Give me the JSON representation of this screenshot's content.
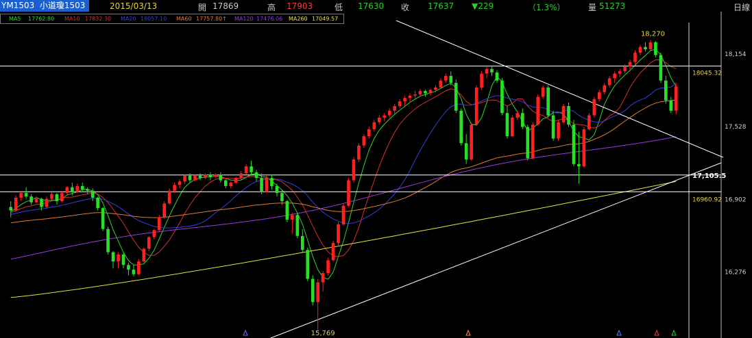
{
  "header": {
    "symbol": "YM1503",
    "name": "小道瓊1503",
    "date": "2015/03/13",
    "open_label": "開",
    "open": "17869",
    "high_label": "高",
    "high": "17903",
    "low_label": "低",
    "low": "17630",
    "close_label": "收",
    "close": "17637",
    "change": "▼229",
    "change_pct": "（1.3%）",
    "volume_label": "量",
    "volume": "51273",
    "period": "日線"
  },
  "ma_legend": [
    {
      "label": "MA5",
      "value": "17762.80",
      "color": "#2dd82d"
    },
    {
      "label": "MA10",
      "value": "17832.30",
      "color": "#d83030"
    },
    {
      "label": "MA20",
      "value": "18057.10",
      "color": "#3040e0"
    },
    {
      "label": "MA60",
      "value": "17757.80↑",
      "color": "#e07a30"
    },
    {
      "label": "MA120",
      "value": "17476.06",
      "color": "#9a3ae0"
    },
    {
      "label": "MA260",
      "value": "17049.57",
      "color": "#e8e040"
    }
  ],
  "colors": {
    "up": "#ff2020",
    "down": "#28e028",
    "bg": "#000000",
    "grid": "#ffffff"
  },
  "chart_data": {
    "type": "candlestick",
    "title": "",
    "ylim": [
      15700,
      18420
    ],
    "y_ticks": [
      "18,154",
      "17,528",
      "16,902",
      "16,276"
    ],
    "levels": [
      {
        "label": "18045.32",
        "value": 18045.32
      },
      {
        "label": "17,105.5",
        "value": 17105.5
      },
      {
        "label": "16960.92",
        "value": 16960.92
      }
    ],
    "annotations": [
      {
        "label": "18,270",
        "value": 18270
      },
      {
        "label": "15,769",
        "value": 15769
      }
    ],
    "candles": [
      [
        16830,
        16880,
        16740,
        16800
      ],
      [
        16800,
        16930,
        16790,
        16910
      ],
      [
        16910,
        16960,
        16880,
        16950
      ],
      [
        16950,
        17000,
        16900,
        16920
      ],
      [
        16920,
        16940,
        16850,
        16870
      ],
      [
        16870,
        16920,
        16860,
        16900
      ],
      [
        16900,
        16910,
        16800,
        16830
      ],
      [
        16830,
        16920,
        16820,
        16900
      ],
      [
        16900,
        16960,
        16890,
        16940
      ],
      [
        16940,
        16950,
        16850,
        16880
      ],
      [
        16880,
        16960,
        16870,
        16950
      ],
      [
        16950,
        17010,
        16930,
        17000
      ],
      [
        17000,
        17040,
        16930,
        16960
      ],
      [
        16960,
        17030,
        16950,
        17010
      ],
      [
        17010,
        17040,
        16960,
        16980
      ],
      [
        16980,
        17000,
        16940,
        16970
      ],
      [
        16970,
        16990,
        16880,
        16910
      ],
      [
        16910,
        16920,
        16800,
        16820
      ],
      [
        16820,
        16830,
        16620,
        16640
      ],
      [
        16640,
        16660,
        16420,
        16440
      ],
      [
        16440,
        16450,
        16300,
        16360
      ],
      [
        16360,
        16440,
        16300,
        16420
      ],
      [
        16420,
        16430,
        16300,
        16330
      ],
      [
        16330,
        16350,
        16240,
        16290
      ],
      [
        16290,
        16330,
        16230,
        16250
      ],
      [
        16250,
        16380,
        16240,
        16360
      ],
      [
        16360,
        16480,
        16350,
        16470
      ],
      [
        16470,
        16580,
        16450,
        16570
      ],
      [
        16570,
        16640,
        16550,
        16630
      ],
      [
        16630,
        16760,
        16620,
        16740
      ],
      [
        16740,
        16880,
        16730,
        16860
      ],
      [
        16860,
        16990,
        16850,
        16970
      ],
      [
        16970,
        17040,
        16950,
        17020
      ],
      [
        17020,
        17070,
        16990,
        17050
      ],
      [
        17050,
        17110,
        17030,
        17100
      ],
      [
        17100,
        17120,
        17040,
        17060
      ],
      [
        17060,
        17110,
        17050,
        17100
      ],
      [
        17100,
        17120,
        17060,
        17080
      ],
      [
        17080,
        17120,
        17070,
        17110
      ],
      [
        17110,
        17130,
        17060,
        17090
      ],
      [
        17090,
        17120,
        17080,
        17110
      ],
      [
        17110,
        17130,
        17040,
        17060
      ],
      [
        17060,
        17070,
        16990,
        17010
      ],
      [
        17010,
        17050,
        16990,
        17040
      ],
      [
        17040,
        17090,
        17030,
        17080
      ],
      [
        17080,
        17140,
        17060,
        17120
      ],
      [
        17120,
        17200,
        17110,
        17180
      ],
      [
        17180,
        17230,
        17100,
        17130
      ],
      [
        17130,
        17150,
        17050,
        17080
      ],
      [
        17080,
        17120,
        16940,
        16960
      ],
      [
        16960,
        17100,
        16950,
        17080
      ],
      [
        17080,
        17110,
        16980,
        17010
      ],
      [
        17010,
        17030,
        16920,
        16950
      ],
      [
        16950,
        16980,
        16850,
        16880
      ],
      [
        16880,
        16890,
        16700,
        16720
      ],
      [
        16720,
        16780,
        16600,
        16760
      ],
      [
        16760,
        16780,
        16560,
        16580
      ],
      [
        16580,
        16640,
        16440,
        16460
      ],
      [
        16460,
        16480,
        16190,
        16210
      ],
      [
        16210,
        16240,
        15980,
        16010
      ],
      [
        16010,
        16210,
        15769,
        16180
      ],
      [
        16180,
        16280,
        16100,
        16260
      ],
      [
        16260,
        16390,
        16240,
        16370
      ],
      [
        16370,
        16540,
        16360,
        16520
      ],
      [
        16520,
        16700,
        16500,
        16680
      ],
      [
        16680,
        16860,
        16670,
        16840
      ],
      [
        16840,
        17080,
        16830,
        17060
      ],
      [
        17060,
        17260,
        17040,
        17240
      ],
      [
        17240,
        17380,
        17220,
        17360
      ],
      [
        17360,
        17460,
        17340,
        17440
      ],
      [
        17440,
        17520,
        17420,
        17500
      ],
      [
        17500,
        17580,
        17480,
        17560
      ],
      [
        17560,
        17620,
        17540,
        17600
      ],
      [
        17600,
        17640,
        17570,
        17620
      ],
      [
        17620,
        17680,
        17600,
        17660
      ],
      [
        17660,
        17720,
        17630,
        17700
      ],
      [
        17700,
        17760,
        17680,
        17740
      ],
      [
        17740,
        17790,
        17700,
        17770
      ],
      [
        17770,
        17810,
        17730,
        17790
      ],
      [
        17790,
        17830,
        17760,
        17800
      ],
      [
        17800,
        17850,
        17780,
        17830
      ],
      [
        17830,
        17840,
        17780,
        17810
      ],
      [
        17810,
        17850,
        17790,
        17840
      ],
      [
        17840,
        17880,
        17820,
        17860
      ],
      [
        17860,
        17940,
        17850,
        17920
      ],
      [
        17920,
        17980,
        17900,
        17960
      ],
      [
        17960,
        18000,
        17880,
        17900
      ],
      [
        17900,
        17930,
        17640,
        17660
      ],
      [
        17660,
        17680,
        17360,
        17380
      ],
      [
        17380,
        17460,
        17200,
        17240
      ],
      [
        17240,
        17560,
        17230,
        17540
      ],
      [
        17540,
        17880,
        17530,
        17860
      ],
      [
        17860,
        18000,
        17840,
        17980
      ],
      [
        17980,
        18040,
        17940,
        18020
      ],
      [
        18020,
        18040,
        17960,
        17990
      ],
      [
        17990,
        18010,
        17900,
        17920
      ],
      [
        17920,
        17940,
        17620,
        17640
      ],
      [
        17640,
        17700,
        17420,
        17440
      ],
      [
        17440,
        17620,
        17430,
        17600
      ],
      [
        17600,
        17660,
        17580,
        17640
      ],
      [
        17640,
        17680,
        17500,
        17520
      ],
      [
        17520,
        17540,
        17230,
        17250
      ],
      [
        17250,
        17560,
        17240,
        17540
      ],
      [
        17540,
        17800,
        17530,
        17780
      ],
      [
        17780,
        17880,
        17760,
        17860
      ],
      [
        17860,
        17880,
        17600,
        17620
      ],
      [
        17620,
        17660,
        17400,
        17420
      ],
      [
        17420,
        17580,
        17400,
        17560
      ],
      [
        17560,
        17720,
        17550,
        17700
      ],
      [
        17700,
        17730,
        17520,
        17540
      ],
      [
        17540,
        17580,
        17180,
        17200
      ],
      [
        17200,
        17480,
        17030,
        17180
      ],
      [
        17180,
        17520,
        17170,
        17500
      ],
      [
        17500,
        17640,
        17490,
        17620
      ],
      [
        17620,
        17780,
        17600,
        17760
      ],
      [
        17760,
        17840,
        17740,
        17820
      ],
      [
        17820,
        17900,
        17800,
        17880
      ],
      [
        17880,
        17960,
        17860,
        17940
      ],
      [
        17940,
        18000,
        17900,
        17980
      ],
      [
        17980,
        18020,
        17950,
        18000
      ],
      [
        18000,
        18060,
        17980,
        18040
      ],
      [
        18040,
        18100,
        18000,
        18080
      ],
      [
        18080,
        18180,
        18060,
        18160
      ],
      [
        18160,
        18230,
        18140,
        18210
      ],
      [
        18210,
        18250,
        18170,
        18190
      ],
      [
        18190,
        18270,
        18180,
        18250
      ],
      [
        18250,
        18260,
        18120,
        18140
      ],
      [
        18140,
        18160,
        17900,
        17920
      ],
      [
        17920,
        17960,
        17720,
        17750
      ],
      [
        17750,
        17780,
        17640,
        17660
      ],
      [
        17660,
        17903,
        17630,
        17869
      ]
    ]
  }
}
